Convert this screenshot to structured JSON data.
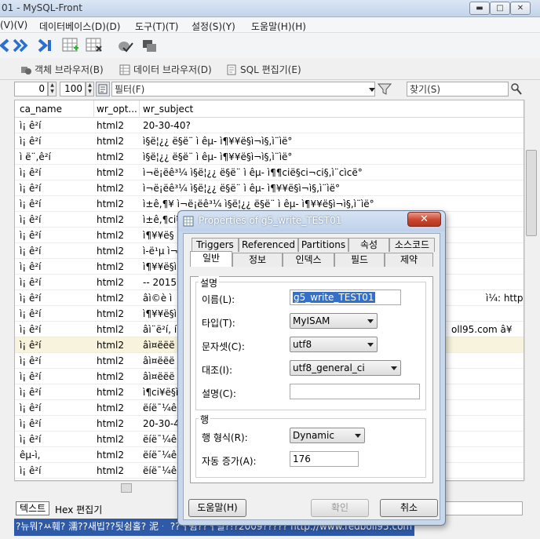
{
  "window": {
    "title": "01 - MySQL-Front"
  },
  "menu": [
    "(V)(V)",
    "데이터베이스(D)(D)",
    "도구(T)(T)",
    "설정(S)(Y)",
    "도움말(H)(H)"
  ],
  "view_tabs": {
    "object_browser": "객체 브라우저(B)",
    "data_browser": "데이터 브라우저(D)",
    "sql_editor": "SQL 편집기(E)"
  },
  "filter_bar": {
    "offset": "0",
    "limit": "100",
    "filter_placeholder": "필터(F)",
    "search_placeholder": "찾기(S)"
  },
  "grid": {
    "columns": [
      "ca_name",
      "wr_opt...",
      "wr_subject"
    ],
    "rows": [
      [
        "ì¡ ê²í",
        "html2",
        "20-30-40?"
      ],
      [
        "ì¡ ê²í",
        "html2",
        "ì§ë¦¿¿ ë§ë¨ ì êµ- ì¶¥¥ë§ì¬ì§,ì¨ìë°"
      ],
      [
        "ì ë¨,ê²í",
        "html2",
        "ì§ë¦¿¿ ë§ë¨ ì êµ- ì¶¥¥ë§ì¬ì§,ì¨ìë°"
      ],
      [
        "ì¡ ê²í",
        "html2",
        "ì¬ë¡ëê³¼ ì§ë¦¿¿ ë§ë¨ ì êµ- ì¶¶cië§ci¬ci§,ì¨cìcë°"
      ],
      [
        "ì¡ ê²í",
        "html2",
        "ì¬ë¡ëê³¼ ì§ë¦¿¿ ë§ë¨ ì êµ- ì¶¥¥ë§ì¬ì§,ì¨ìë°"
      ],
      [
        "ì¡ ê²í",
        "html2",
        "ì±ê,¶¥ ì¬ë¡ëê³¼ ì§ë¦¿¿ ë§ë¨ ì êµ- ì¶¥¥ë§ì¬ì§,ì¨ìë°"
      ],
      [
        "ì¡ ê²í",
        "html2",
        "ì±ê,¶ci¥"
      ],
      [
        "ì¡ ê²í",
        "html2",
        "ì¶¥¥ë§"
      ],
      [
        "ì¡ ê²í",
        "html2",
        "ì-ë¹µ ì¬ë"
      ],
      [
        "ì¡ ê²í",
        "html2",
        "ì¶¥¥ë§ì"
      ],
      [
        "ì¡ ê²í",
        "html2",
        "-- 2015."
      ],
      [
        "ì¡ ê²í",
        "html2",
        "âì©è ì"
      ],
      [
        "ì¡ ê²í",
        "html2",
        "ì¶¥¥ë§ì"
      ],
      [
        "ì¡ ê²í",
        "html2",
        "âì¨ë²í, í"
      ],
      [
        "ì¡ ê²í",
        "html2",
        "âì¤ëëë"
      ],
      [
        "ì¡ ê²í",
        "html2",
        "âì¤ëëë"
      ],
      [
        "ì¡ ê²í",
        "html2",
        "âì¤ëëë"
      ],
      [
        "ì¡ ê²í",
        "html2",
        "ì¶ci¥ë§ì"
      ],
      [
        "ì¡ ê²í",
        "html2",
        "ëíë¯¼êµ"
      ],
      [
        "ì¡ ê²í",
        "html2",
        "20-30-4"
      ],
      [
        "ì¡ ê²í",
        "html2",
        "ëíë¯¼êµ"
      ],
      [
        "êµ-ì,",
        "html2",
        "ëíë¯¼êµ"
      ],
      [
        "ì¡ ê²í",
        "html2",
        "ëíë¯¼êµ"
      ]
    ],
    "overflow_texts": [
      "ì¼: http://www.rec",
      "oll95.com â¥"
    ]
  },
  "bottom_tabs": {
    "text": "텍스트",
    "hex": "Hex 편집기"
  },
  "blob_text": "?뉴뭐?ㅆ훼? 濡??새빕??됫쉼홀?  泥ᆞ ??ㅓ쉼??ㅓ벌?!?2009????? http://www.redboll95.com ??",
  "dialog": {
    "title": "Properties of g5_write_TEST01",
    "tabs_row1": [
      "Triggers",
      "Referenced",
      "Partitions",
      "속성",
      "소스코드"
    ],
    "tabs_row2": [
      "일반",
      "정보",
      "인덱스",
      "필드",
      "제약"
    ],
    "group_settings": "설명",
    "labels": {
      "name": "이름(L):",
      "type": "타입(T):",
      "charset": "문자셋(C):",
      "collation": "대조(I):",
      "comment": "설명(C):"
    },
    "values": {
      "name": "g5_write_TEST01",
      "type": "MyISAM",
      "charset": "utf8",
      "collation": "utf8_general_ci",
      "comment": ""
    },
    "group_rows": "행",
    "row_labels": {
      "row_format": "행 형식(R):",
      "auto_increment": "자동 증가(A):"
    },
    "row_values": {
      "row_format": "Dynamic",
      "auto_increment": "176"
    },
    "buttons": {
      "help": "도움말(H)",
      "ok": "확인",
      "cancel": "취소"
    }
  }
}
